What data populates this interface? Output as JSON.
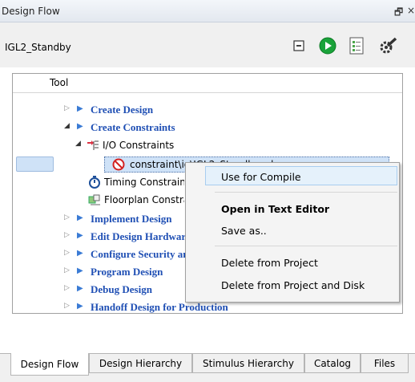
{
  "panel": {
    "title": "Design Flow",
    "float_glyph": "🗗",
    "close_glyph": "×"
  },
  "design": {
    "name": "IGL2_Standby"
  },
  "toolbar": {
    "icons": [
      "collapse-icon",
      "run-icon",
      "report-icon",
      "settings-wrench-icon"
    ]
  },
  "tree": {
    "header": "Tool",
    "items": [
      {
        "label": "Create Design"
      },
      {
        "label": "Create Constraints"
      },
      {
        "label": "I/O Constraints"
      },
      {
        "label": "constraint\\io\\IGL2_Standby.pdc"
      },
      {
        "label": "Timing Constraints"
      },
      {
        "label": "Floorplan Constraints"
      },
      {
        "label": "Implement Design"
      },
      {
        "label": "Edit Design Hardware Configuration"
      },
      {
        "label": "Configure Security and Programming Options"
      },
      {
        "label": "Program Design"
      },
      {
        "label": "Debug Design"
      },
      {
        "label": "Handoff Design for Production"
      }
    ]
  },
  "context_menu": {
    "items": [
      {
        "label": "Use for Compile"
      },
      {
        "label": "Open in Text Editor"
      },
      {
        "label": "Save as.."
      },
      {
        "label": "Delete from Project"
      },
      {
        "label": "Delete from Project and Disk"
      }
    ]
  },
  "tabs": [
    {
      "label": "Design Flow"
    },
    {
      "label": "Design Hierarchy"
    },
    {
      "label": "Stimulus Hierarchy"
    },
    {
      "label": "Catalog"
    },
    {
      "label": "Files"
    }
  ],
  "colors": {
    "link_blue": "#1f4fb4",
    "selection": "#cfe2f7",
    "run_green": "#1aa33a"
  }
}
